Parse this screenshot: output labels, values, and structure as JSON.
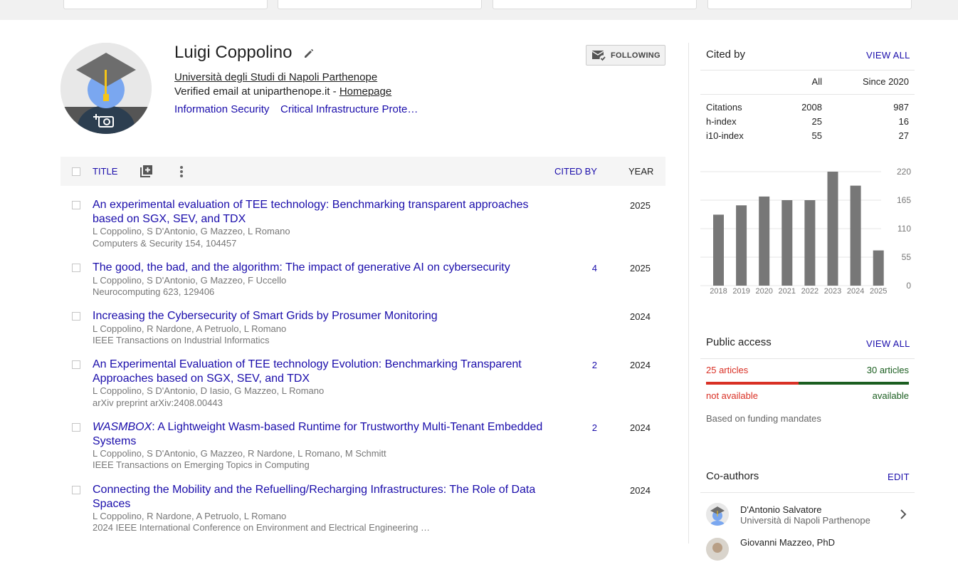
{
  "profile": {
    "name": "Luigi Coppolino",
    "affiliation": "Università degli Studi di Napoli Parthenope",
    "verified_email": "Verified email at uniparthenope.it - ",
    "homepage_label": "Homepage",
    "interests": [
      "Information Security",
      "Critical Infrastructure Prote…"
    ],
    "follow_label": "FOLLOWING"
  },
  "table": {
    "title_header": "TITLE",
    "cited_by_header": "CITED BY",
    "year_header": "YEAR"
  },
  "articles": [
    {
      "title": "An experimental evaluation of TEE technology: Benchmarking transparent approaches based on SGX, SEV, and TDX",
      "authors": "L Coppolino, S D'Antonio, G Mazzeo, L Romano",
      "venue": "Computers & Security 154, 104457",
      "cited": "",
      "year": "2025"
    },
    {
      "title": "The good, the bad, and the algorithm: The impact of generative AI on cybersecurity",
      "authors": "L Coppolino, S D'Antonio, G Mazzeo, F Uccello",
      "venue": "Neurocomputing 623, 129406",
      "cited": "4",
      "year": "2025"
    },
    {
      "title": "Increasing the Cybersecurity of Smart Grids by Prosumer Monitoring",
      "authors": "L Coppolino, R Nardone, A Petruolo, L Romano",
      "venue": "IEEE Transactions on Industrial Informatics",
      "cited": "",
      "year": "2024"
    },
    {
      "title": "An Experimental Evaluation of TEE technology Evolution: Benchmarking Transparent Approaches based on SGX, SEV, and TDX",
      "authors": "L Coppolino, S D'Antonio, D Iasio, G Mazzeo, L Romano",
      "venue": "arXiv preprint arXiv:2408.00443",
      "cited": "2",
      "year": "2024"
    },
    {
      "title_italic": "WASMBOX",
      "title": ": A Lightweight Wasm-based Runtime for Trustworthy Multi-Tenant Embedded Systems",
      "authors": "L Coppolino, S D'Antonio, G Mazzeo, R Nardone, L Romano, M Schmitt",
      "venue": "IEEE Transactions on Emerging Topics in Computing",
      "cited": "2",
      "year": "2024"
    },
    {
      "title": "Connecting the Mobility and the Refuelling/Recharging Infrastructures: The Role of Data Spaces",
      "authors": "L Coppolino, R Nardone, A Petruolo, L Romano",
      "venue": "2024 IEEE International Conference on Environment and Electrical Engineering …",
      "cited": "",
      "year": "2024"
    }
  ],
  "cited_by": {
    "heading": "Cited by",
    "view_all": "VIEW ALL",
    "col_all": "All",
    "col_since": "Since 2020",
    "rows": [
      {
        "label": "Citations",
        "all": "2008",
        "since": "987"
      },
      {
        "label": "h-index",
        "all": "25",
        "since": "16"
      },
      {
        "label": "i10-index",
        "all": "55",
        "since": "27"
      }
    ]
  },
  "chart_data": {
    "type": "bar",
    "categories": [
      "2018",
      "2019",
      "2020",
      "2021",
      "2022",
      "2023",
      "2024",
      "2025"
    ],
    "values": [
      137,
      155,
      172,
      165,
      165,
      220,
      193,
      68
    ],
    "y_ticks": [
      "220",
      "165",
      "110",
      "55",
      "0"
    ],
    "ylim": [
      0,
      220
    ],
    "grid": true,
    "bar_color": "#777777"
  },
  "public_access": {
    "heading": "Public access",
    "view_all": "VIEW ALL",
    "not_available_count": "25 articles",
    "available_count": "30 articles",
    "not_available_label": "not available",
    "available_label": "available",
    "not_available_n": 25,
    "available_n": 30,
    "note": "Based on funding mandates"
  },
  "coauthors": {
    "heading": "Co-authors",
    "edit": "EDIT",
    "items": [
      {
        "name": "D'Antonio Salvatore",
        "affiliation": "Università di Napoli Parthenope"
      },
      {
        "name": "Giovanni Mazzeo, PhD",
        "affiliation": ""
      }
    ]
  }
}
